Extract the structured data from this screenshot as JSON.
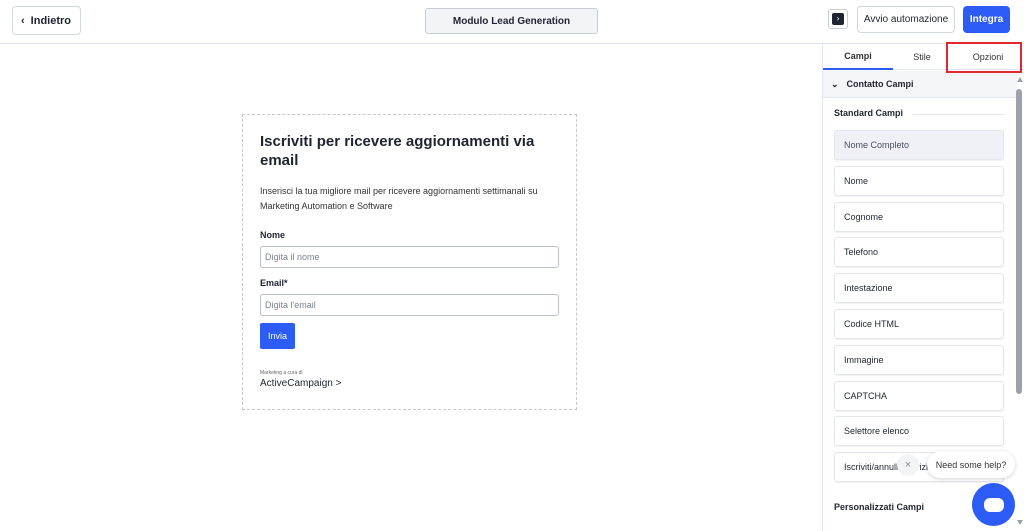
{
  "header": {
    "back_label": "Indietro",
    "title": "Modulo Lead Generation",
    "automation_label": "Avvio automazione",
    "integrate_label": "Integra"
  },
  "form": {
    "title": "Iscriviti per ricevere aggiornamenti via email",
    "description": "Inserisci la tua migliore mail per ricevere aggiornamenti settimanali su Marketing Automation e Software",
    "name_label": "Nome",
    "name_placeholder": "Digita il nome",
    "email_label": "Email*",
    "email_placeholder": "Digita l'email",
    "submit_label": "Invia",
    "powered_by": "Marketing a cura di",
    "brand": "ActiveCampaign >"
  },
  "sidebar": {
    "tabs": [
      "Campi",
      "Stile",
      "Opzioni"
    ],
    "section_title": "Contatto Campi",
    "standard_title": "Standard Campi",
    "fields": [
      "Nome Completo",
      "Nome",
      "Cognome",
      "Telefono",
      "Intestazione",
      "Codice HTML",
      "Immagine",
      "CAPTCHA",
      "Selettore elenco",
      "Iscriviti/annulla iscrizione"
    ],
    "custom_title": "Personalizzati Campi"
  },
  "help": {
    "text": "Need some help?",
    "close": "×"
  },
  "colors": {
    "accent": "#2d5bf5",
    "highlight": "#e0262e"
  }
}
